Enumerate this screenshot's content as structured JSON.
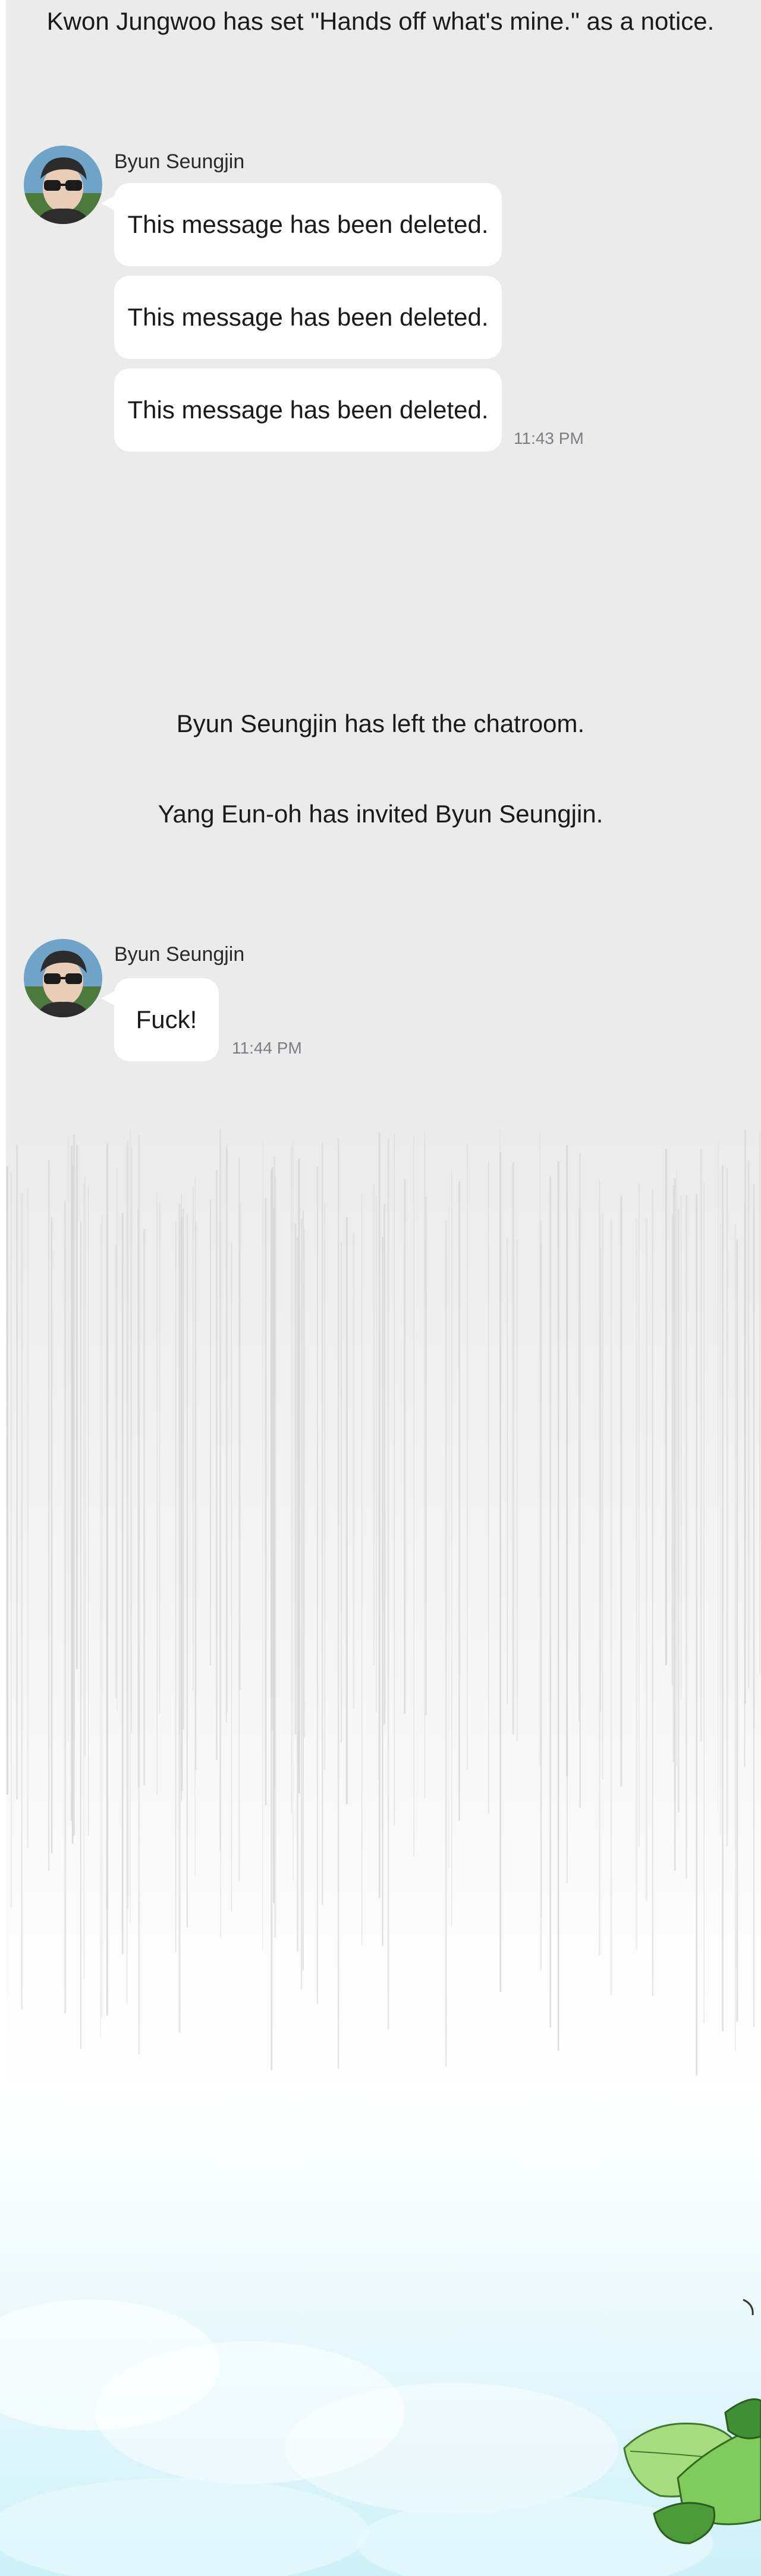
{
  "notices": {
    "notice_set": "Kwon Jungwoo has set \"Hands off what's mine.\" as a notice.",
    "left_chatroom": "Byun Seungjin has left the chatroom.",
    "invited": "Yang Eun-oh has invited Byun Seungjin."
  },
  "group1": {
    "sender": "Byun Seungjin",
    "messages": [
      "This message has been deleted.",
      "This message has been deleted.",
      "This message has been deleted."
    ],
    "time": "11:43 PM"
  },
  "group2": {
    "sender": "Byun Seungjin",
    "message": "Fuck!",
    "time": "11:44 PM"
  },
  "colors": {
    "chat_background": "#ebebeb",
    "bubble": "#ffffff",
    "timestamp": "#7d7d86",
    "sky": "#cdf1f8",
    "leaf": "#8fd36a"
  }
}
